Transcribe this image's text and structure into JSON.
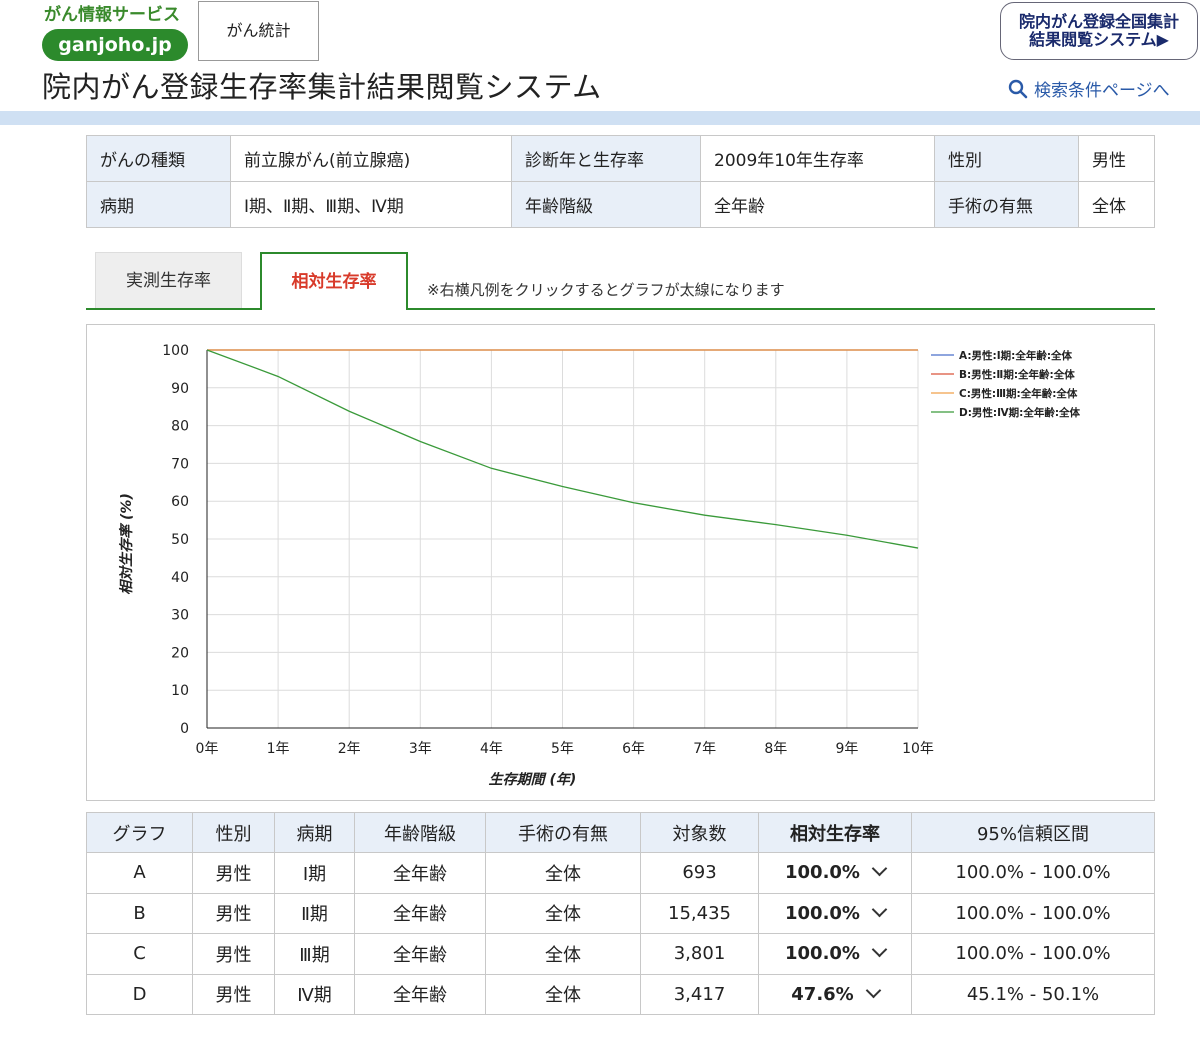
{
  "header": {
    "logo_text": "がん情報サービス",
    "logo_pill": "ganjoho.jp",
    "stats_button": "がん統計",
    "app_title": "院内がん登録生存率集計結果閲覧システム",
    "system_link_line1": "院内がん登録全国集計",
    "system_link_line2": "結果閲覧システム▶",
    "search_link": "検索条件ページへ"
  },
  "conditions": {
    "row1": [
      {
        "label": "がんの種類",
        "value": "前立腺がん(前立腺癌)"
      },
      {
        "label": "診断年と生存率",
        "value": "2009年10年生存率"
      },
      {
        "label": "性別",
        "value": "男性"
      }
    ],
    "row2": [
      {
        "label": "病期",
        "value": "Ⅰ期、Ⅱ期、Ⅲ期、Ⅳ期"
      },
      {
        "label": "年齢階級",
        "value": "全年齢"
      },
      {
        "label": "手術の有無",
        "value": "全体"
      }
    ]
  },
  "tabs": {
    "observed": "実測生存率",
    "relative": "相対生存率",
    "note": "※右横凡例をクリックするとグラフが太線になります"
  },
  "chart_data": {
    "type": "line",
    "xlabel": "生存期間 (年)",
    "ylabel": "相対生存率 (%)",
    "x": [
      0,
      1,
      2,
      3,
      4,
      5,
      6,
      7,
      8,
      9,
      10
    ],
    "x_tick_labels": [
      "0年",
      "1年",
      "2年",
      "3年",
      "4年",
      "5年",
      "6年",
      "7年",
      "8年",
      "9年",
      "10年"
    ],
    "y_ticks": [
      0,
      10,
      20,
      30,
      40,
      50,
      60,
      70,
      80,
      90,
      100
    ],
    "ylim": [
      0,
      100
    ],
    "grid": true,
    "legend_position": "right",
    "series": [
      {
        "name": "A:男性:Ⅰ期:全年齢:全体",
        "color": "#4a6fc9",
        "values": [
          100,
          100,
          100,
          100,
          100,
          100,
          100,
          100,
          100,
          100,
          100
        ]
      },
      {
        "name": "B:男性:Ⅱ期:全年齢:全体",
        "color": "#d9533a",
        "values": [
          100,
          100,
          100,
          100,
          100,
          100,
          100,
          100,
          100,
          100,
          100
        ]
      },
      {
        "name": "C:男性:Ⅲ期:全年齢:全体",
        "color": "#f0a04a",
        "values": [
          100,
          100,
          100,
          100,
          100,
          100,
          100,
          100,
          100,
          100,
          100
        ]
      },
      {
        "name": "D:男性:Ⅳ期:全年齢:全体",
        "color": "#3a9a3a",
        "values": [
          100,
          93,
          83.8,
          75.8,
          68.7,
          63.9,
          59.6,
          56.3,
          53.8,
          51.0,
          47.6
        ]
      }
    ]
  },
  "results": {
    "headers": [
      "グラフ",
      "性別",
      "病期",
      "年齢階級",
      "手術の有無",
      "対象数",
      "相対生存率",
      "95%信頼区間"
    ],
    "rows": [
      {
        "graph": "A",
        "sex": "男性",
        "stage": "Ⅰ期",
        "age": "全年齢",
        "surgery": "全体",
        "n": "693",
        "rate": "100.0%",
        "ci": "100.0% - 100.0%"
      },
      {
        "graph": "B",
        "sex": "男性",
        "stage": "Ⅱ期",
        "age": "全年齢",
        "surgery": "全体",
        "n": "15,435",
        "rate": "100.0%",
        "ci": "100.0% - 100.0%"
      },
      {
        "graph": "C",
        "sex": "男性",
        "stage": "Ⅲ期",
        "age": "全年齢",
        "surgery": "全体",
        "n": "3,801",
        "rate": "100.0%",
        "ci": "100.0% - 100.0%"
      },
      {
        "graph": "D",
        "sex": "男性",
        "stage": "Ⅳ期",
        "age": "全年齢",
        "surgery": "全体",
        "n": "3,417",
        "rate": "47.6%",
        "ci": "45.1% - 50.1%"
      }
    ]
  }
}
